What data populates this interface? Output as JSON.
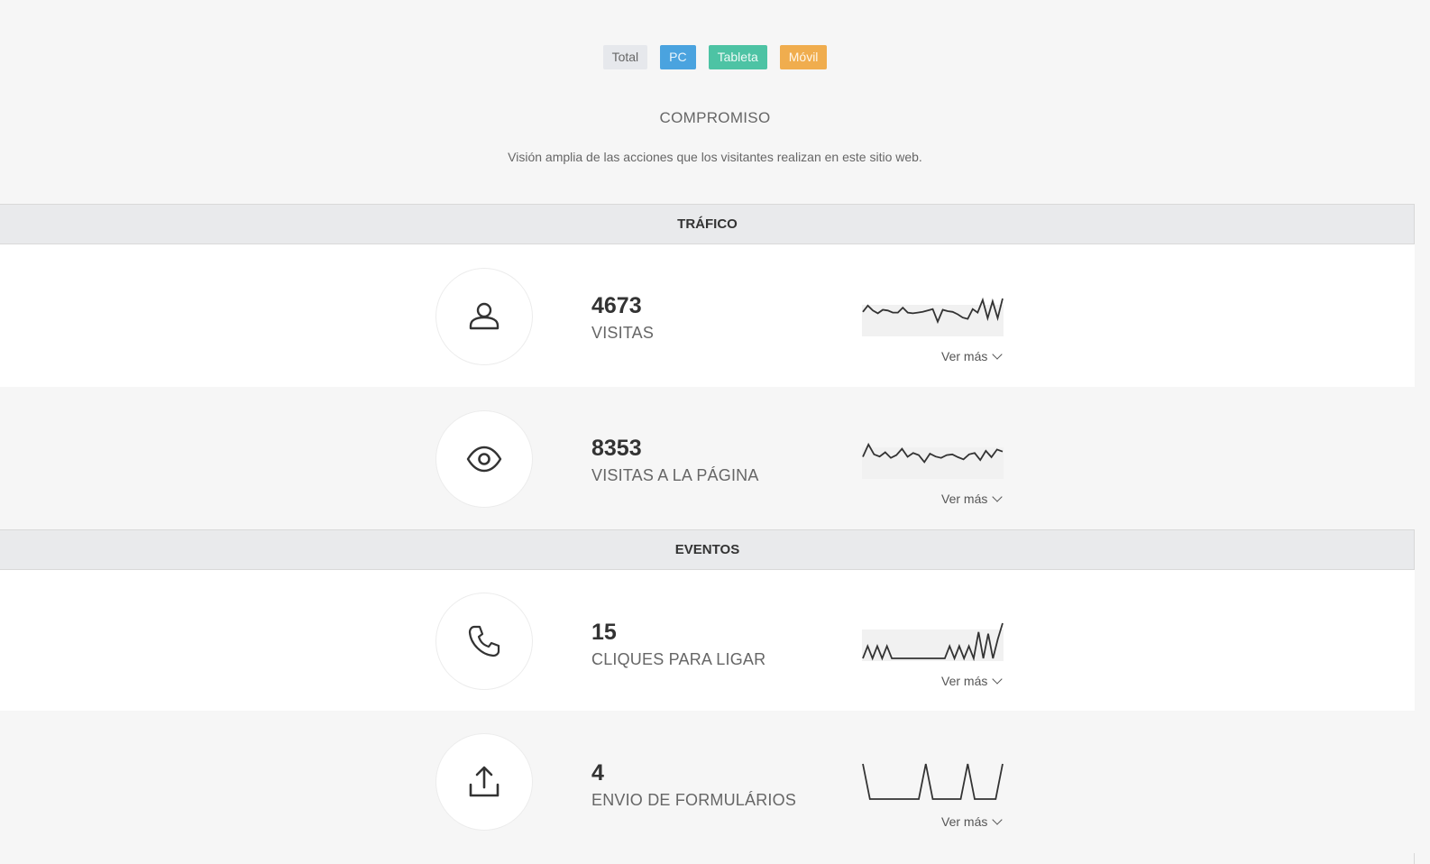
{
  "filters": [
    {
      "label": "Total",
      "color": "#e6e8ec"
    },
    {
      "label": "PC",
      "color": "#4aa3df"
    },
    {
      "label": "Tableta",
      "color": "#4dc3a4"
    },
    {
      "label": "Móvil",
      "color": "#f0ad4e"
    }
  ],
  "header": {
    "title": "COMPROMISO",
    "subtitle": "Visión amplia de las acciones que los visitantes realizan en este sitio web."
  },
  "sections": [
    {
      "title": "TRÁFICO",
      "metrics": [
        {
          "icon": "user-icon",
          "value": "4673",
          "label": "VISITAS",
          "more": "Ver más",
          "spark": [
            0.62,
            0.8,
            0.66,
            0.58,
            0.68,
            0.66,
            0.6,
            0.6,
            0.74,
            0.6,
            0.58,
            0.6,
            0.62,
            0.66,
            0.7,
            0.34,
            0.68,
            0.64,
            0.62,
            0.55,
            0.46,
            0.42,
            0.7,
            0.6,
            0.96,
            0.44,
            0.92,
            0.44,
            1.0
          ]
        },
        {
          "icon": "eye-icon",
          "value": "8353",
          "label": "VISITAS A LA PÁGINA",
          "more": "Ver más",
          "spark": [
            0.55,
            0.9,
            0.62,
            0.56,
            0.68,
            0.52,
            0.6,
            0.78,
            0.55,
            0.66,
            0.6,
            0.4,
            0.64,
            0.56,
            0.52,
            0.6,
            0.62,
            0.54,
            0.48,
            0.62,
            0.66,
            0.46,
            0.72,
            0.54,
            0.76,
            0.7
          ]
        }
      ]
    },
    {
      "title": "EVENTOS",
      "metrics": [
        {
          "icon": "phone-icon",
          "value": "15",
          "label": "CLIQUES PARA LIGAR",
          "more": "Ver más",
          "spark": [
            0,
            0.35,
            0,
            0.35,
            0,
            0.35,
            0,
            0,
            0,
            0,
            0,
            0,
            0,
            0,
            0,
            0,
            0,
            0,
            0.35,
            0,
            0.35,
            0,
            0.35,
            0,
            0.75,
            0,
            0.7,
            0,
            0.55,
            1.0
          ]
        },
        {
          "icon": "upload-icon",
          "value": "4",
          "label": "ENVIO DE FORMULÁRIOS",
          "more": "Ver más",
          "spark": [
            1,
            0,
            0,
            0,
            0,
            0,
            0,
            0,
            0,
            1,
            0,
            0,
            0,
            0,
            0,
            1,
            0,
            0,
            0,
            0,
            1
          ]
        }
      ]
    }
  ]
}
